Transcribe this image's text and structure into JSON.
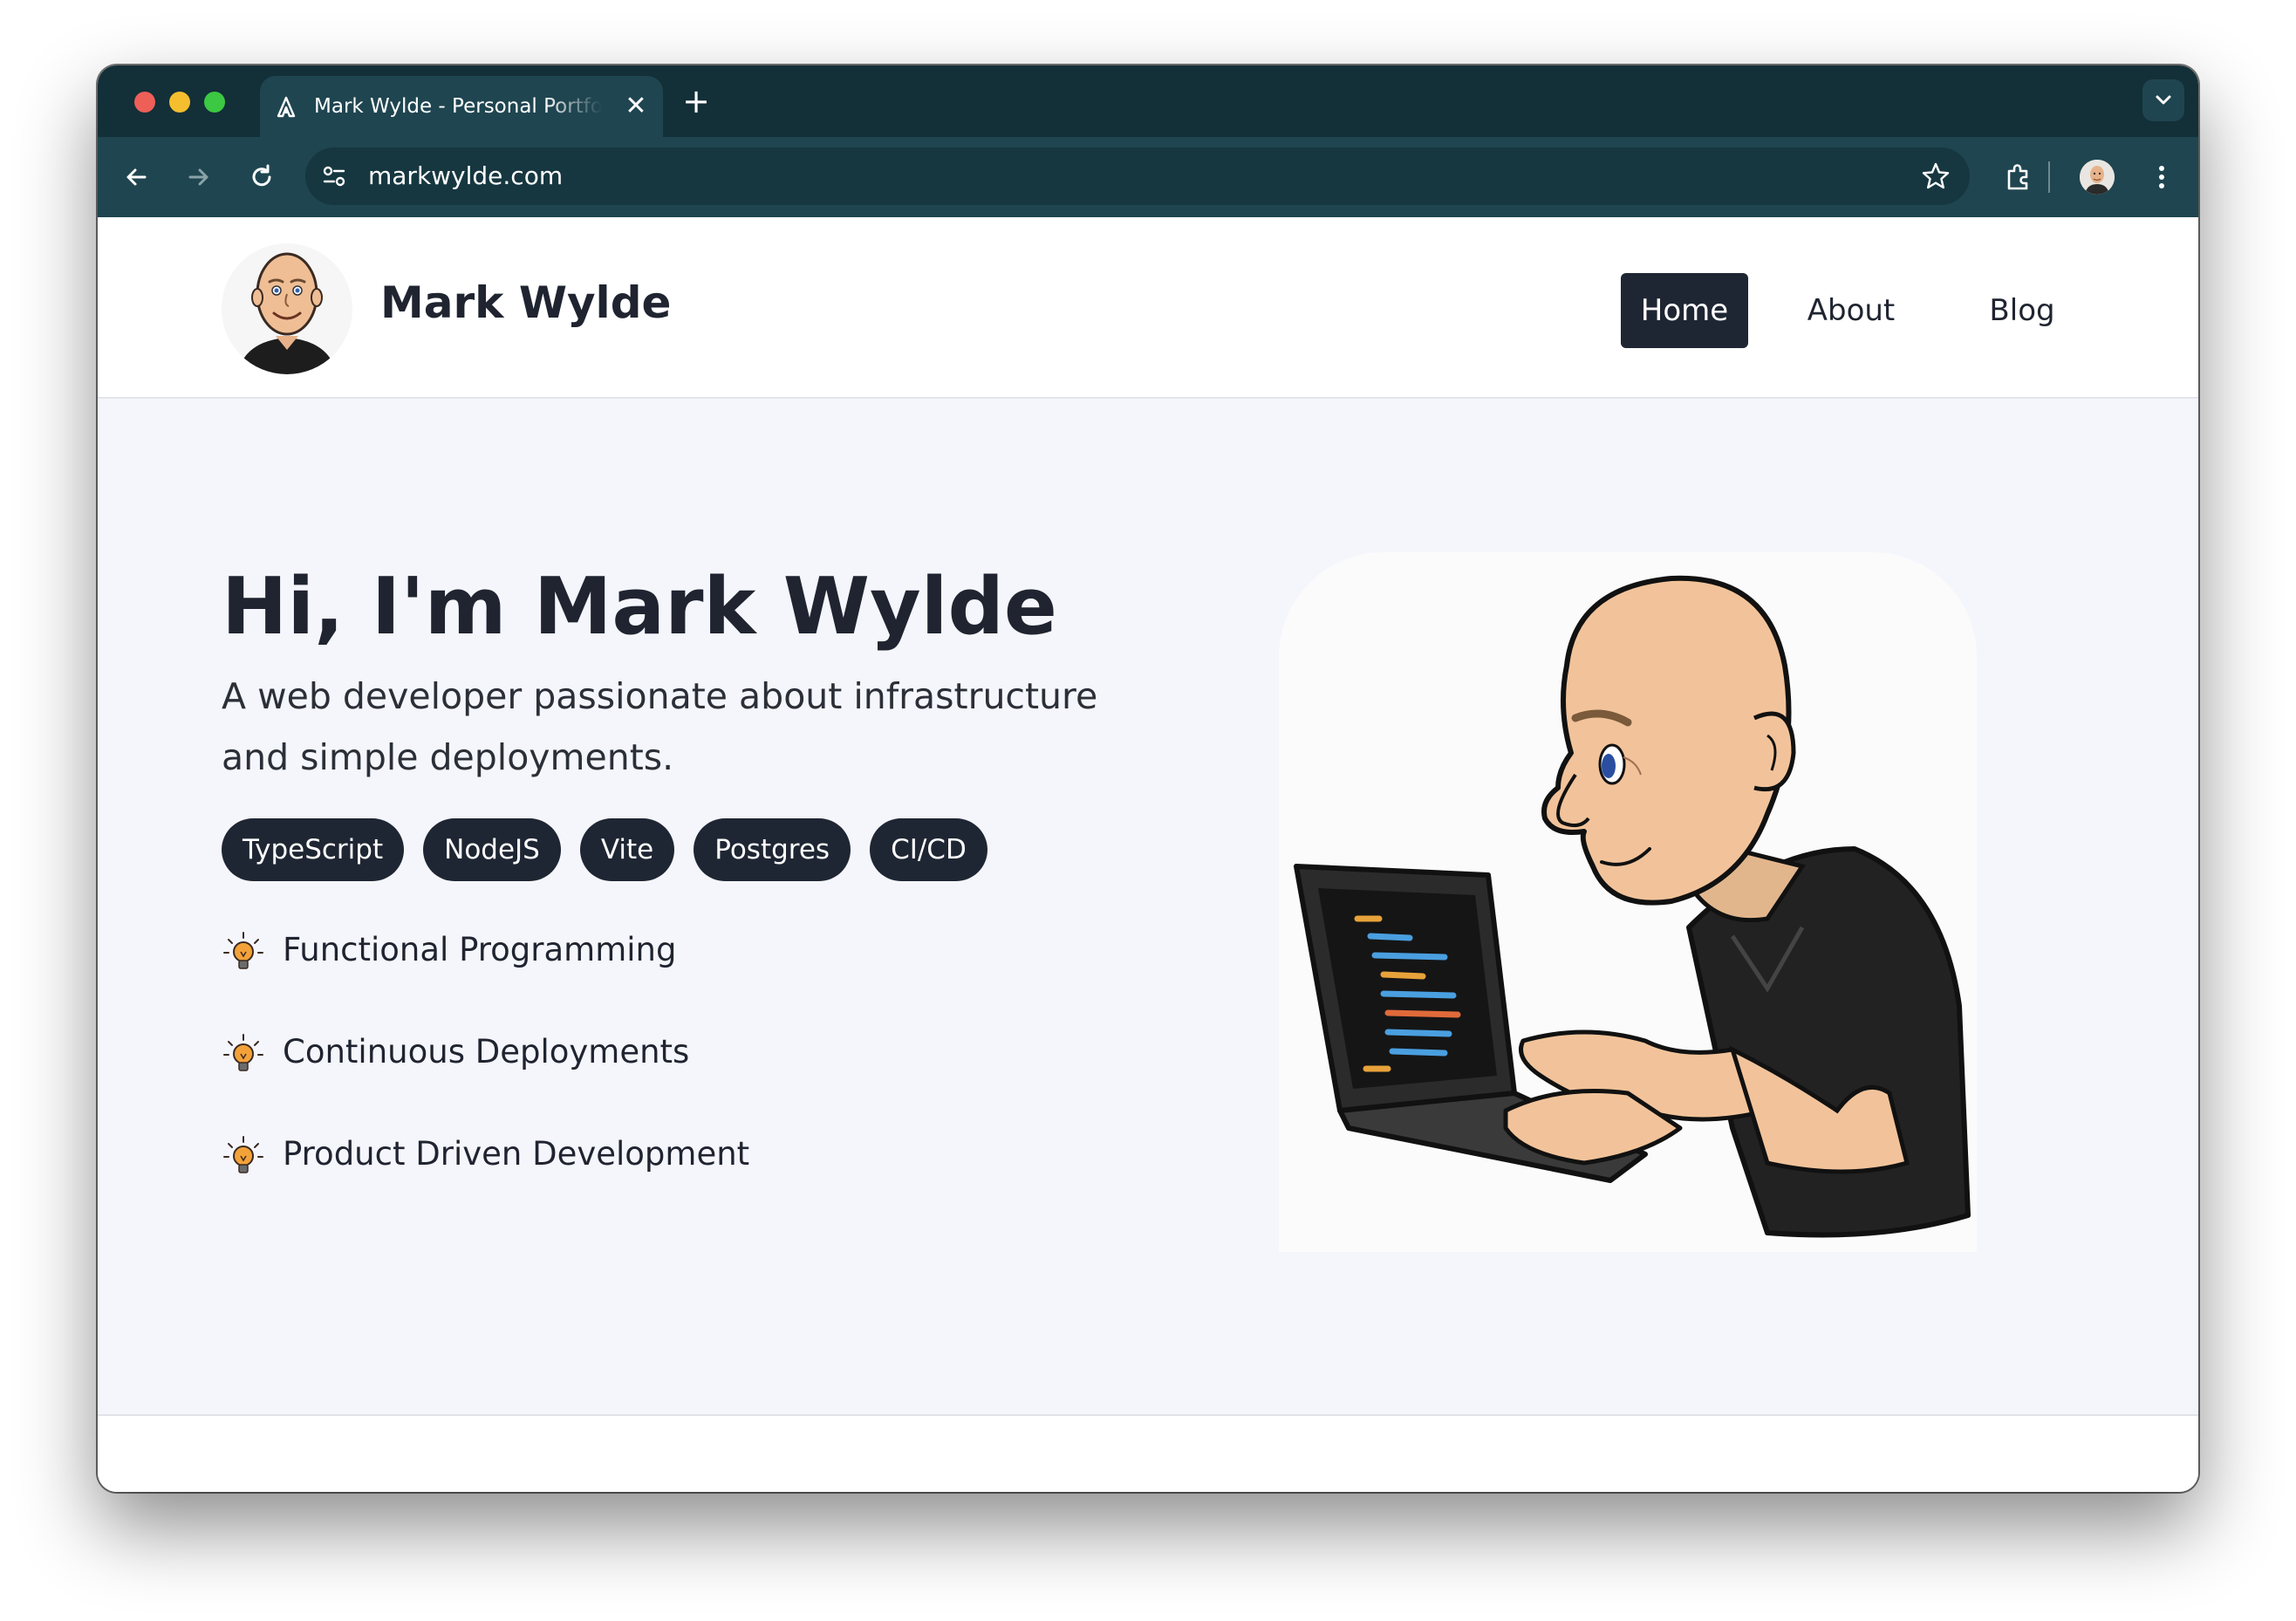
{
  "browser": {
    "tab_title": "Mark Wylde - Personal Portfolio",
    "tab_close_glyph": "✕",
    "new_tab_glyph": "+",
    "url": "markwylde.com",
    "icons": [
      "back-arrow-icon",
      "forward-arrow-icon",
      "reload-icon",
      "site-settings-icon",
      "bookmark-star-icon",
      "extensions-icon",
      "profile-avatar",
      "more-menu-icon",
      "tab-search-icon"
    ]
  },
  "site": {
    "name": "Mark Wylde",
    "nav": [
      {
        "label": "Home",
        "active": true
      },
      {
        "label": "About",
        "active": false
      },
      {
        "label": "Blog",
        "active": false
      }
    ]
  },
  "hero": {
    "title": "Hi, I'm Mark Wylde",
    "subtitle": "A web developer passionate about infrastructure and simple deployments.",
    "skills": [
      "TypeScript",
      "NodeJS",
      "Vite",
      "Postgres",
      "CI/CD"
    ],
    "features": [
      "Functional Programming",
      "Continuous Deployments",
      "Product Driven Development"
    ],
    "feature_icon": "lightbulb-icon",
    "illustration": "developer-at-laptop-illustration"
  },
  "colors": {
    "chrome_dark": "#132f38",
    "chrome_toolbar": "#1f4550",
    "nav_active_bg": "#1f2633",
    "chip_bg": "#1f2633",
    "hero_bg": "#f5f6fc",
    "text_primary": "#1f2430"
  }
}
